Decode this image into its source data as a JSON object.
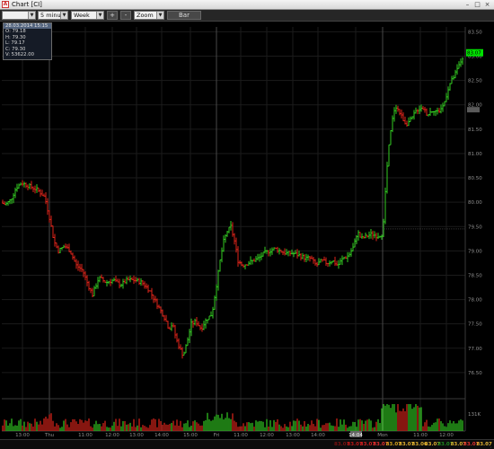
{
  "window": {
    "title": "Chart [CI]"
  },
  "toolbar": {
    "symbol_value": "",
    "interval_value": "5 minutes",
    "range_value": "Week",
    "zoom_in_label": "+",
    "zoom_out_label": "-",
    "zoom_value": "Zoom",
    "chart_type_label": "Bar"
  },
  "info_box": {
    "header": "28.03.2014 15:15",
    "open": "O: 79.18",
    "high": "H: 79.30",
    "low": "L: 79.17",
    "close": "C: 79.30",
    "volume": "V: 53622.00"
  },
  "colors": {
    "up": "#33cc22",
    "down": "#e0251a",
    "background": "#000000",
    "grid": "#1b1b1b",
    "session_divider": "#6a6a6a",
    "last_price_label": "#00e000"
  },
  "status_quotes": [
    {
      "text": "83.07",
      "color": "#7a1010"
    },
    {
      "text": "83.07",
      "color": "#c01818"
    },
    {
      "text": "83.07",
      "color": "#d02020"
    },
    {
      "text": "83.07",
      "color": "#e23030"
    },
    {
      "text": "83.07",
      "color": "#d6a21c"
    },
    {
      "text": "83.07",
      "color": "#e0b030"
    },
    {
      "text": "83.06",
      "color": "#e0b030"
    },
    {
      "text": "83.07",
      "color": "#e0b030"
    },
    {
      "text": "83.07",
      "color": "#1f8a1f"
    },
    {
      "text": "83.07",
      "color": "#e0b030"
    },
    {
      "text": "83.07",
      "color": "#e23030"
    },
    {
      "text": "83.07",
      "color": "#e0b030"
    }
  ],
  "chart_data": {
    "type": "bar",
    "style": "ohlc",
    "title": "",
    "price_axis": {
      "ylim": [
        76.0,
        83.6
      ],
      "ticks": [
        "83.50",
        "83.00",
        "82.50",
        "82.00",
        "81.50",
        "81.00",
        "80.50",
        "80.00",
        "79.50",
        "79.00",
        "78.50",
        "78.00",
        "77.50",
        "77.00",
        "76.50"
      ],
      "last_price": "83.07",
      "marker_price": "81.9"
    },
    "volume_axis": {
      "ylim": [
        0,
        260000
      ],
      "ticks": [
        "131K"
      ]
    },
    "time_axis": {
      "ticks": [
        "13:00",
        "Thu",
        "11:00",
        "12:00",
        "13:00",
        "14:00",
        "15:00",
        "Fri",
        "11:00",
        "12:00",
        "13:00",
        "14:00",
        "14:04",
        "Mon",
        "11:00",
        "12:00"
      ],
      "session_breaks": [
        "Thu",
        "Fri",
        "Mon"
      ]
    },
    "grid": true,
    "close_path": [
      [
        0,
        80.0
      ],
      [
        6,
        79.95
      ],
      [
        12,
        80.05
      ],
      [
        18,
        80.3
      ],
      [
        24,
        80.4
      ],
      [
        30,
        80.35
      ],
      [
        36,
        80.3
      ],
      [
        42,
        80.25
      ],
      [
        50,
        80.1
      ],
      [
        56,
        79.6
      ],
      [
        60,
        79.2
      ],
      [
        65,
        79.0
      ],
      [
        72,
        79.1
      ],
      [
        78,
        79.0
      ],
      [
        85,
        78.7
      ],
      [
        92,
        78.6
      ],
      [
        98,
        78.3
      ],
      [
        103,
        78.1
      ],
      [
        110,
        78.45
      ],
      [
        118,
        78.35
      ],
      [
        126,
        78.4
      ],
      [
        134,
        78.3
      ],
      [
        142,
        78.4
      ],
      [
        150,
        78.4
      ],
      [
        158,
        78.35
      ],
      [
        166,
        78.2
      ],
      [
        172,
        78.0
      ],
      [
        178,
        77.8
      ],
      [
        184,
        77.6
      ],
      [
        188,
        77.4
      ],
      [
        192,
        77.5
      ],
      [
        196,
        77.2
      ],
      [
        200,
        77.0
      ],
      [
        204,
        76.85
      ],
      [
        208,
        77.1
      ],
      [
        213,
        77.5
      ],
      [
        218,
        77.55
      ],
      [
        224,
        77.4
      ],
      [
        230,
        77.6
      ],
      [
        236,
        77.7
      ],
      [
        241,
        78.3
      ],
      [
        245,
        78.8
      ],
      [
        249,
        79.2
      ],
      [
        253,
        79.4
      ],
      [
        257,
        79.5
      ],
      [
        261,
        79.2
      ],
      [
        265,
        78.8
      ],
      [
        270,
        78.7
      ],
      [
        276,
        78.75
      ],
      [
        282,
        78.8
      ],
      [
        288,
        78.85
      ],
      [
        294,
        78.95
      ],
      [
        300,
        79.0
      ],
      [
        306,
        79.05
      ],
      [
        312,
        79.0
      ],
      [
        318,
        78.95
      ],
      [
        326,
        78.95
      ],
      [
        334,
        78.9
      ],
      [
        340,
        78.85
      ],
      [
        346,
        78.85
      ],
      [
        352,
        78.7
      ],
      [
        358,
        78.8
      ],
      [
        364,
        78.75
      ],
      [
        370,
        78.8
      ],
      [
        376,
        78.7
      ],
      [
        382,
        78.85
      ],
      [
        388,
        78.9
      ],
      [
        394,
        79.1
      ],
      [
        398,
        79.4
      ],
      [
        402,
        79.25
      ],
      [
        408,
        79.3
      ],
      [
        414,
        79.35
      ],
      [
        420,
        79.3
      ],
      [
        426,
        79.35
      ],
      [
        429,
        80.2
      ],
      [
        432,
        81.0
      ],
      [
        436,
        81.6
      ],
      [
        440,
        82.0
      ],
      [
        446,
        81.8
      ],
      [
        452,
        81.6
      ],
      [
        458,
        81.7
      ],
      [
        464,
        81.9
      ],
      [
        470,
        81.95
      ],
      [
        476,
        81.8
      ],
      [
        482,
        81.9
      ],
      [
        488,
        81.85
      ],
      [
        494,
        82.0
      ],
      [
        500,
        82.4
      ],
      [
        506,
        82.6
      ],
      [
        512,
        82.85
      ],
      [
        518,
        83.07
      ]
    ]
  }
}
